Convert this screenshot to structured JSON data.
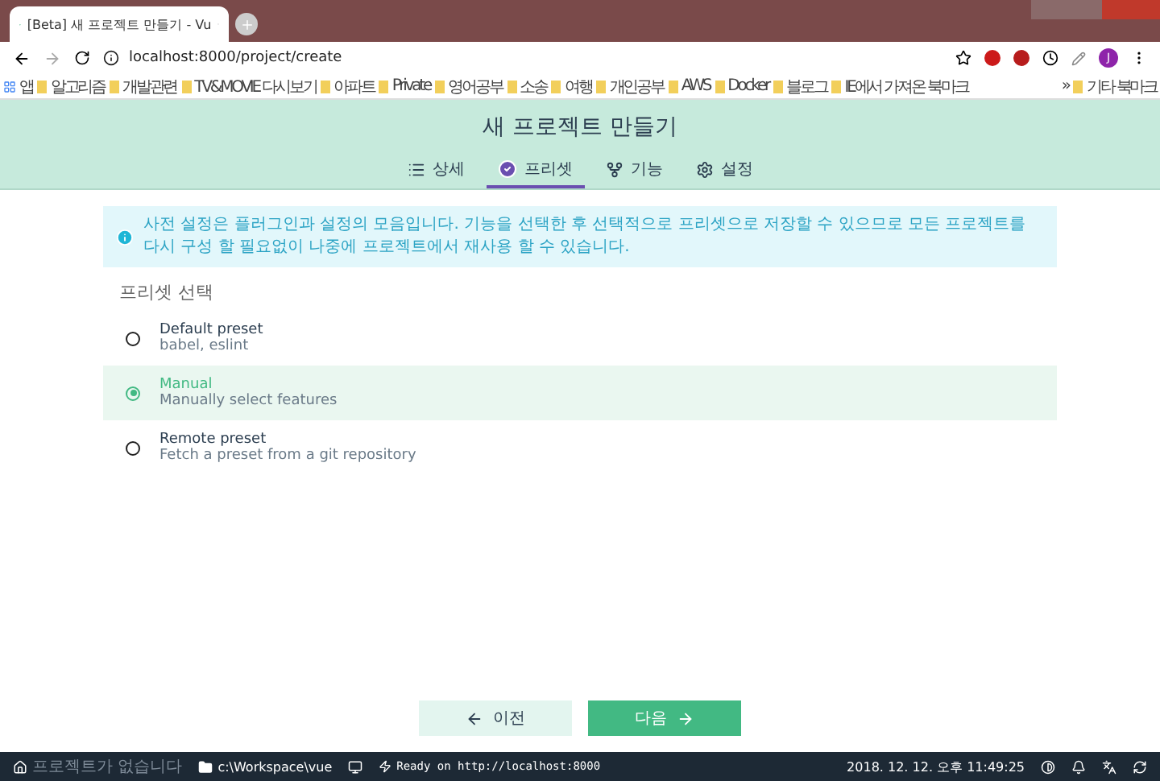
{
  "browser": {
    "tab_title": "[Beta] 새 프로젝트 만들기 - Vu",
    "address": "localhost:8000/project/create",
    "avatar": "J",
    "bookmarks": [
      {
        "label": "앱",
        "kind": "apps"
      },
      {
        "label": "알고리즘",
        "kind": "folder"
      },
      {
        "label": "개발관련",
        "kind": "folder"
      },
      {
        "label": "TV&MOVIE 다시보기",
        "kind": "folder"
      },
      {
        "label": "아파트",
        "kind": "folder"
      },
      {
        "label": "Private",
        "kind": "folder"
      },
      {
        "label": "영어공부",
        "kind": "folder"
      },
      {
        "label": "소송",
        "kind": "folder"
      },
      {
        "label": "여행",
        "kind": "folder"
      },
      {
        "label": "개인공부",
        "kind": "folder"
      },
      {
        "label": "AWS",
        "kind": "folder"
      },
      {
        "label": "Docker",
        "kind": "folder"
      },
      {
        "label": "블로그",
        "kind": "folder"
      },
      {
        "label": "IE에서 가져온 북마크",
        "kind": "folder"
      },
      {
        "label": "»",
        "kind": "more"
      },
      {
        "label": "기타 북마크",
        "kind": "folder"
      }
    ]
  },
  "header": {
    "title": "새 프로젝트 만들기",
    "tabs": [
      {
        "label": "상세",
        "selected": false
      },
      {
        "label": "프리셋",
        "selected": true
      },
      {
        "label": "기능",
        "selected": false
      },
      {
        "label": "설정",
        "selected": false
      }
    ]
  },
  "info": "사전 설정은 플러그인과 설정의 모음입니다. 기능을 선택한 후 선택적으로 프리셋으로 저장할 수 있으므로 모든 프로젝트를 다시 구성 할 필요없이 나중에 프로젝트에서 재사용 할 수 있습니다.",
  "section_title": "프리셋 선택",
  "presets": [
    {
      "name": "Default preset",
      "description": "babel, eslint",
      "selected": false
    },
    {
      "name": "Manual",
      "description": "Manually select features",
      "selected": true
    },
    {
      "name": "Remote preset",
      "description": "Fetch a preset from a git repository",
      "selected": false
    }
  ],
  "buttons": {
    "back": "이전",
    "next": "다음"
  },
  "status_bar": {
    "project": "프로젝트가 없습니다",
    "folder": "c:\\Workspace\\vue",
    "server": "Ready on http://localhost:8000",
    "time": "2018. 12. 12. 오후 11:49:25"
  }
}
